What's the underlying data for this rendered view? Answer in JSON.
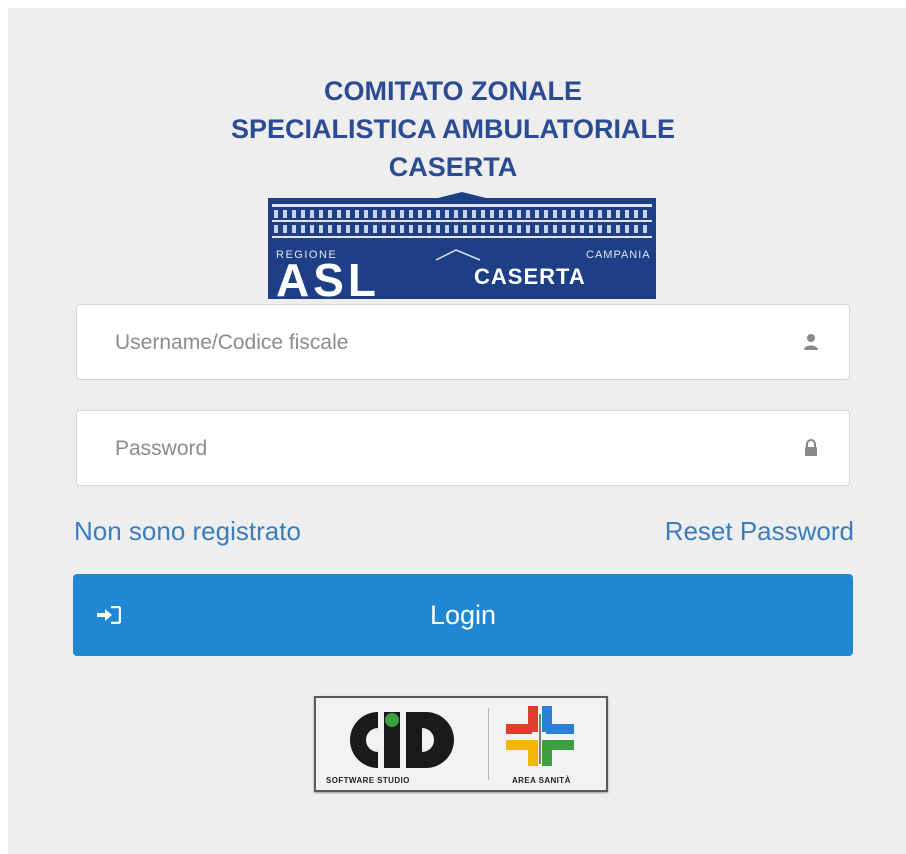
{
  "header": {
    "title_lines": [
      "COMITATO ZONALE",
      "SPECIALISTICA AMBULATORIALE",
      "CASERTA"
    ]
  },
  "logo": {
    "region_left": "REGIONE",
    "region_right": "CAMPANIA",
    "acronym": "ASL",
    "city": "CASERTA"
  },
  "form": {
    "username_placeholder": "Username/Codice fiscale",
    "password_placeholder": "Password",
    "username_icon": "user-icon",
    "password_icon": "lock-icon"
  },
  "links": {
    "register": "Non sono registrato",
    "reset": "Reset Password"
  },
  "login_button": {
    "label": "Login",
    "icon": "sign-in-icon"
  },
  "vendor": {
    "left_caption": "SOFTWARE STUDIO",
    "right_caption": "AREA SANITÀ"
  },
  "colors": {
    "title": "#2b4b93",
    "link": "#3a7dbf",
    "button": "#1f87d3",
    "panel": "#eeeeee"
  }
}
